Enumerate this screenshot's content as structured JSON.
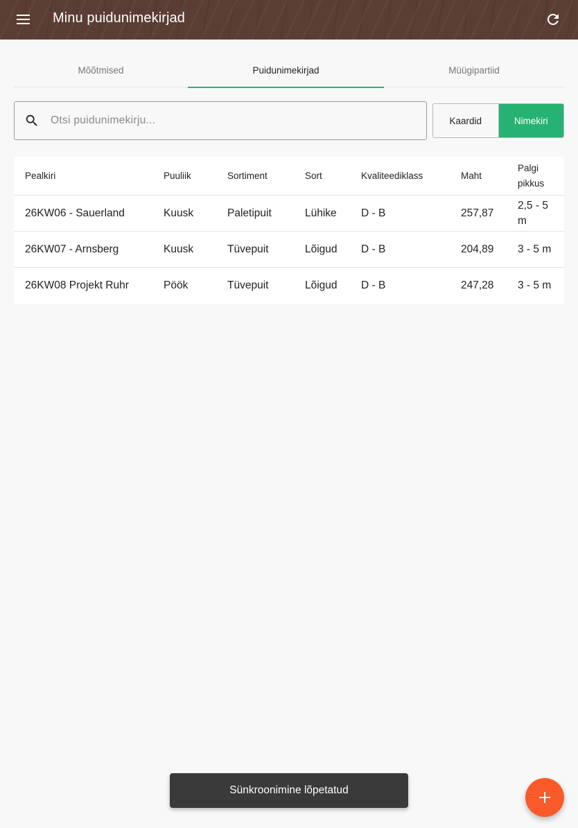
{
  "appbar": {
    "title": "Minu puidunimekirjad",
    "menu_icon": "menu-icon",
    "refresh_icon": "refresh-icon",
    "color": "#5a3d33"
  },
  "tabs": [
    {
      "label": "Mõõtmised",
      "active": false
    },
    {
      "label": "Puidunimekirjad",
      "active": true
    },
    {
      "label": "Müügipartiid",
      "active": false
    }
  ],
  "search": {
    "placeholder": "Otsi puidunimekirju...",
    "value": "",
    "icon": "search-icon"
  },
  "view_toggle": {
    "cards_label": "Kaardid",
    "list_label": "Nimekiri",
    "selected": "Nimekiri",
    "accent": "#26b272"
  },
  "table": {
    "headers": [
      "Pealkiri",
      "Puuliik",
      "Sortiment",
      "Sort",
      "Kvaliteediklass",
      "Maht",
      "Palgi pikkus"
    ],
    "rows": [
      [
        "26KW06 - Sauerland",
        "Kuusk",
        "Paletipuit",
        "Lühike",
        "D - B",
        "257,87",
        "2,5 - 5 m"
      ],
      [
        "26KW07 - Arnsberg",
        "Kuusk",
        "Tüvepuit",
        "Lõigud",
        "D - B",
        "204,89",
        "3 - 5 m"
      ],
      [
        "26KW08 Projekt Ruhr",
        "Pöök",
        "Tüvepuit",
        "Lõigud",
        "D - B",
        "247,28",
        "3 - 5 m"
      ]
    ]
  },
  "snackbar": {
    "message": "Sünkroonimine lõpetatud"
  },
  "fab": {
    "icon": "plus-icon",
    "color": "#fa5a2a"
  }
}
